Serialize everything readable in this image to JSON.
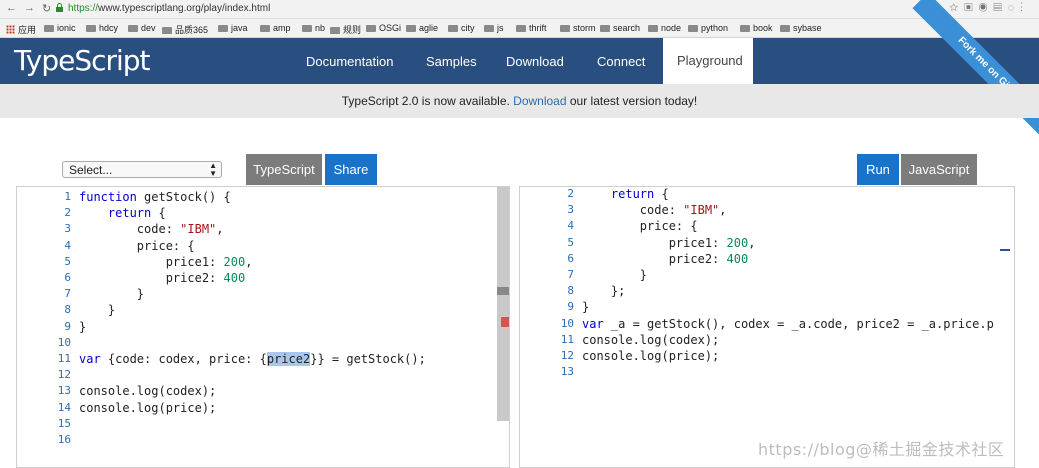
{
  "browser": {
    "nav_icons": [
      "back-icon",
      "forward-icon",
      "reload-icon"
    ],
    "url_scheme": "https://",
    "url_rest": "www.typescriptlang.org/play/index.html",
    "bookmarks": [
      "应用",
      "ionic",
      "hdcy",
      "dev",
      "品质365",
      "java",
      "amp",
      "nb",
      "规则",
      "OSGi",
      "aglie",
      "city",
      "js",
      "thrift",
      "storm",
      "search",
      "node",
      "python",
      "book",
      "sybase"
    ]
  },
  "header": {
    "logo": "TypeScript",
    "nav": [
      "Documentation",
      "Samples",
      "Download",
      "Connect",
      "Playground"
    ],
    "ribbon": "Fork me on GitHub"
  },
  "announcement": {
    "before": "TypeScript 2.0 is now available. ",
    "link": "Download",
    "after": " our latest version today!"
  },
  "controls": {
    "select_value": "Select...",
    "left_tab": "TypeScript",
    "share": "Share",
    "run": "Run",
    "right_tab": "JavaScript"
  },
  "left_editor": {
    "lines": [
      {
        "n": "1",
        "text": "function getStock() {"
      },
      {
        "n": "2",
        "text": "    return {"
      },
      {
        "n": "3",
        "text": "        code: \"IBM\","
      },
      {
        "n": "4",
        "text": "        price: {"
      },
      {
        "n": "5",
        "text": "            price1: 200,"
      },
      {
        "n": "6",
        "text": "            price2: 400"
      },
      {
        "n": "7",
        "text": "        }"
      },
      {
        "n": "8",
        "text": "    }"
      },
      {
        "n": "9",
        "text": "}"
      },
      {
        "n": "10",
        "text": ""
      },
      {
        "n": "11",
        "text": "var {code: codex, price: {price2}} = getStock();"
      },
      {
        "n": "12",
        "text": ""
      },
      {
        "n": "13",
        "text": "console.log(codex);"
      },
      {
        "n": "14",
        "text": "console.log(price);"
      },
      {
        "n": "15",
        "text": ""
      },
      {
        "n": "16",
        "text": ""
      }
    ]
  },
  "right_editor": {
    "lines": [
      {
        "n": "2",
        "text": "    return {"
      },
      {
        "n": "3",
        "text": "        code: \"IBM\","
      },
      {
        "n": "4",
        "text": "        price: {"
      },
      {
        "n": "5",
        "text": "            price1: 200,"
      },
      {
        "n": "6",
        "text": "            price2: 400"
      },
      {
        "n": "7",
        "text": "        }"
      },
      {
        "n": "8",
        "text": "    };"
      },
      {
        "n": "9",
        "text": "}"
      },
      {
        "n": "10",
        "text": "var _a = getStock(), codex = _a.code, price2 = _a.price.p"
      },
      {
        "n": "11",
        "text": "console.log(codex);"
      },
      {
        "n": "12",
        "text": "console.log(price);"
      },
      {
        "n": "13",
        "text": ""
      }
    ]
  },
  "watermark": "https://blog@稀土掘金技术社区"
}
